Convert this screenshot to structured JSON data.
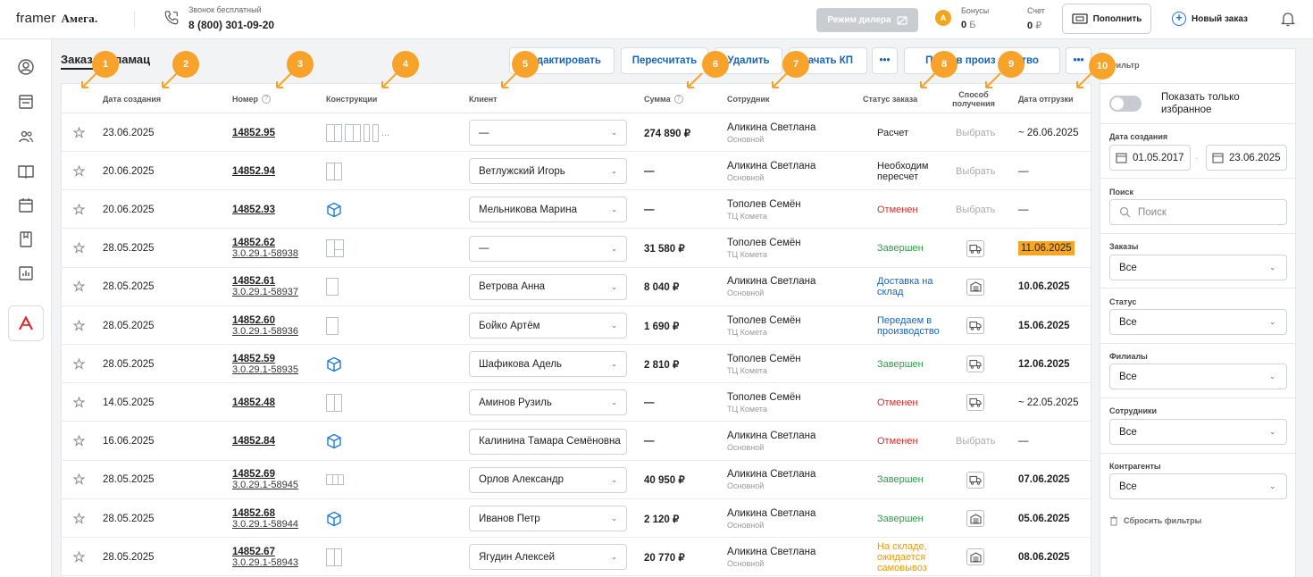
{
  "topbar": {
    "logo": "framer",
    "logo_sub": "Амега.",
    "call_label": "Звонок бесплатный",
    "call_number": "8 (800) 301-09-20",
    "dealer_mode": "Режим дилера",
    "bonus_label": "Бонусы",
    "bonus_value": "0",
    "bonus_unit": "Б",
    "account_label": "Счет",
    "account_value": "0",
    "account_unit": "₽",
    "topup_label": "Пополнить",
    "new_order_label": "Новый заказ"
  },
  "tabs": [
    "Заказ",
    "Рекламац"
  ],
  "actions": {
    "edit": "дактировать",
    "recalc": "Пересчитать",
    "delete": "Удалить",
    "download": "качать КП",
    "more1": "•••",
    "send": "Пере  в произ       ство",
    "more2": "•••"
  },
  "columns": {
    "date": "Дата создания",
    "number": "Номер",
    "constructions": "Конструкции",
    "client": "Клиент",
    "sum": "Сумма",
    "employee": "Сотрудник",
    "status": "Статус заказа",
    "receive_1": "Способ",
    "receive_2": "получения",
    "ship": "Дата отгрузки"
  },
  "rows": [
    {
      "date": "23.06.2025",
      "number": "14852.95",
      "sub": "",
      "con": "multi",
      "client": "—",
      "sum": "274 890 ₽",
      "emp": "Аликина Светлана",
      "branch": "Основной",
      "status": "Расчет",
      "sc": "gray",
      "recv": "Выбрать",
      "recv_icon": "",
      "ship": "~ 26.06.2025",
      "ship_style": "normal"
    },
    {
      "date": "20.06.2025",
      "number": "14852.94",
      "sub": "",
      "con": "split",
      "client": "Ветлужский Игорь",
      "sum": "—",
      "emp": "Аликина Светлана",
      "branch": "Основной",
      "status": "Необходим пересчет",
      "sc": "gray",
      "recv": "Выбрать",
      "recv_icon": "",
      "ship": "—",
      "ship_style": "normal"
    },
    {
      "date": "20.06.2025",
      "number": "14852.93",
      "sub": "",
      "con": "cube",
      "client": "Мельникова Марина",
      "sum": "—",
      "emp": "Тополев Семён",
      "branch": "ТЦ Комета",
      "status": "Отменен",
      "sc": "red",
      "recv": "Выбрать",
      "recv_icon": "",
      "ship": "—",
      "ship_style": "normal"
    },
    {
      "date": "28.05.2025",
      "number": "14852.62",
      "sub": "3.0.29.1-58938",
      "con": "pair",
      "client": "—",
      "sum": "31 580 ₽",
      "emp": "Тополев Семён",
      "branch": "ТЦ Комета",
      "status": "Завершен",
      "sc": "green",
      "recv": "",
      "recv_icon": "truck",
      "ship": "11.06.2025",
      "ship_style": "highlight"
    },
    {
      "date": "28.05.2025",
      "number": "14852.61",
      "sub": "3.0.29.1-58937",
      "con": "tall",
      "client": "Ветрова Анна",
      "sum": "8 040 ₽",
      "emp": "Аликина Светлана",
      "branch": "Основной",
      "status": "Доставка на склад",
      "sc": "blue",
      "recv": "",
      "recv_icon": "warehouse",
      "ship": "10.06.2025",
      "ship_style": "bold"
    },
    {
      "date": "28.05.2025",
      "number": "14852.60",
      "sub": "3.0.29.1-58936",
      "con": "tall",
      "client": "Бойко Артём",
      "sum": "1 690 ₽",
      "emp": "Тополев Семён",
      "branch": "ТЦ Комета",
      "status": "Передаем в производство",
      "sc": "blue",
      "recv": "",
      "recv_icon": "truck",
      "ship": "15.06.2025",
      "ship_style": "bold"
    },
    {
      "date": "28.05.2025",
      "number": "14852.59",
      "sub": "3.0.29.1-58935",
      "con": "cube",
      "client": "Шафикова Адель",
      "sum": "2 810 ₽",
      "emp": "Тополев Семён",
      "branch": "ТЦ Комета",
      "status": "Завершен",
      "sc": "green",
      "recv": "",
      "recv_icon": "truck",
      "ship": "12.06.2025",
      "ship_style": "bold"
    },
    {
      "date": "14.05.2025",
      "number": "14852.48",
      "sub": "",
      "con": "split",
      "client": "Аминов Рузиль",
      "sum": "—",
      "emp": "Тополев Семён",
      "branch": "ТЦ Комета",
      "status": "Отменен",
      "sc": "red",
      "recv": "",
      "recv_icon": "truck",
      "ship": "~ 22.05.2025",
      "ship_style": "normal"
    },
    {
      "date": "16.06.2025",
      "number": "14852.84",
      "sub": "",
      "con": "cube",
      "client": "Калинина Тамара Семёновна",
      "sum": "—",
      "emp": "Аликина Светлана",
      "branch": "Основной",
      "status": "Отменен",
      "sc": "red",
      "recv": "Выбрать",
      "recv_icon": "",
      "ship": "—",
      "ship_style": "normal"
    },
    {
      "date": "28.05.2025",
      "number": "14852.69",
      "sub": "3.0.29.1-58945",
      "con": "tri",
      "client": "Орлов Александр",
      "sum": "40 950 ₽",
      "emp": "Аликина Светлана",
      "branch": "Основной",
      "status": "Завершен",
      "sc": "green",
      "recv": "",
      "recv_icon": "truck",
      "ship": "07.06.2025",
      "ship_style": "bold"
    },
    {
      "date": "28.05.2025",
      "number": "14852.68",
      "sub": "3.0.29.1-58944",
      "con": "cube",
      "client": "Иванов Петр",
      "sum": "2 120 ₽",
      "emp": "Аликина Светлана",
      "branch": "Основной",
      "status": "Завершен",
      "sc": "green",
      "recv": "",
      "recv_icon": "warehouse",
      "ship": "05.06.2025",
      "ship_style": "bold"
    },
    {
      "date": "28.05.2025",
      "number": "14852.67",
      "sub": "3.0.29.1-58943",
      "con": "split",
      "client": "Ягудин Алексей",
      "sum": "20 770 ₽",
      "emp": "Аликина Светлана",
      "branch": "Основной",
      "status": "На складе, ожидается самовывоз",
      "sc": "orange",
      "recv": "",
      "recv_icon": "warehouse",
      "ship": "08.06.2025",
      "ship_style": "bold"
    }
  ],
  "filters": {
    "title": "Фильтр",
    "fav_label": "Показать только избранное",
    "date_label": "Дата создания",
    "date_from": "01.05.2017",
    "date_to": "23.06.2025",
    "search_label": "Поиск",
    "search_placeholder": "Поиск",
    "orders_label": "Заказы",
    "orders_value": "Все",
    "status_label": "Статус",
    "status_value": "Все",
    "branches_label": "Филиалы",
    "branches_value": "Все",
    "employees_label": "Сотрудники",
    "employees_value": "Все",
    "counterparties_label": "Контрагенты",
    "counterparties_value": "Все",
    "reset_label": "Сбросить фильтры"
  },
  "callouts": [
    "1",
    "2",
    "3",
    "4",
    "5",
    "6",
    "7",
    "8",
    "9",
    "10"
  ],
  "colors": {
    "accent": "#1565c0",
    "callout": "#f7a32b",
    "ship_highlight": "#f5a623",
    "status_green": "#2e9e47",
    "status_red": "#d32f2f",
    "status_orange": "#f09b00"
  }
}
